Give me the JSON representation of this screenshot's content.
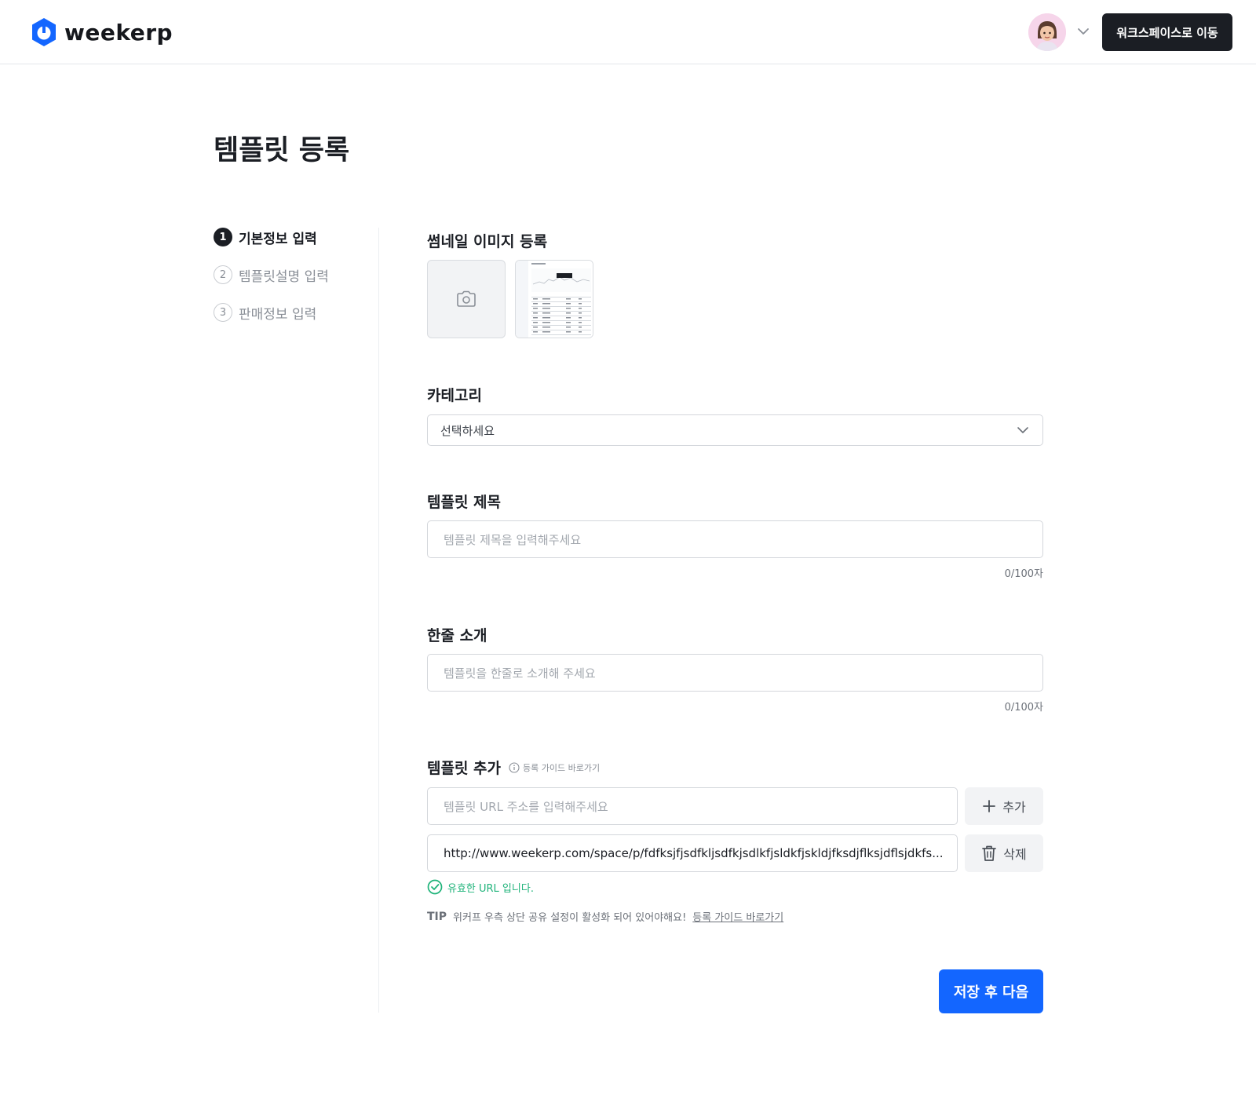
{
  "header": {
    "brand": "weekerp",
    "workspace_button": "워크스페이스로 이동",
    "brand_color": "#1366ff"
  },
  "page": {
    "title": "템플릿 등록"
  },
  "steps": [
    {
      "num": "1",
      "label": "기본정보 입력",
      "active": true
    },
    {
      "num": "2",
      "label": "템플릿설명 입력",
      "active": false
    },
    {
      "num": "3",
      "label": "판매정보 입력",
      "active": false
    }
  ],
  "thumbnail": {
    "title": "썸네일 이미지 등록",
    "icon": "camera-icon"
  },
  "category": {
    "title": "카테고리",
    "selected": "선택하세요"
  },
  "template_title": {
    "title": "템플릿 제목",
    "placeholder": "템플릿 제목을 입력해주세요",
    "counter": "0/100자"
  },
  "one_line_intro": {
    "title": "한줄 소개",
    "placeholder": "템플릿을 한줄로 소개해 주세요",
    "counter": "0/100자"
  },
  "template_add": {
    "title": "템플릿 추가",
    "guide_link": "등록 가이드 바로가기",
    "url_placeholder": "템플릿 URL 주소를 입력해주세요",
    "add_label": "추가",
    "url_value": "http://www.weekerp.com/space/p/fdfksjfjsdfkljsdfkjsdlkfjsldkfjskldjfksdjflksjdflsjdkfs...",
    "delete_label": "삭제",
    "valid_message": "유효한 URL 입니다.",
    "valid_color": "#1fb37a",
    "tip_tag": "TIP",
    "tip_text": "위커프 우측 상단 공유 설정이 활성화 되어 있어야해요!",
    "tip_link": "등록 가이드 바로가기"
  },
  "footer": {
    "save_next": "저장 후 다음"
  }
}
